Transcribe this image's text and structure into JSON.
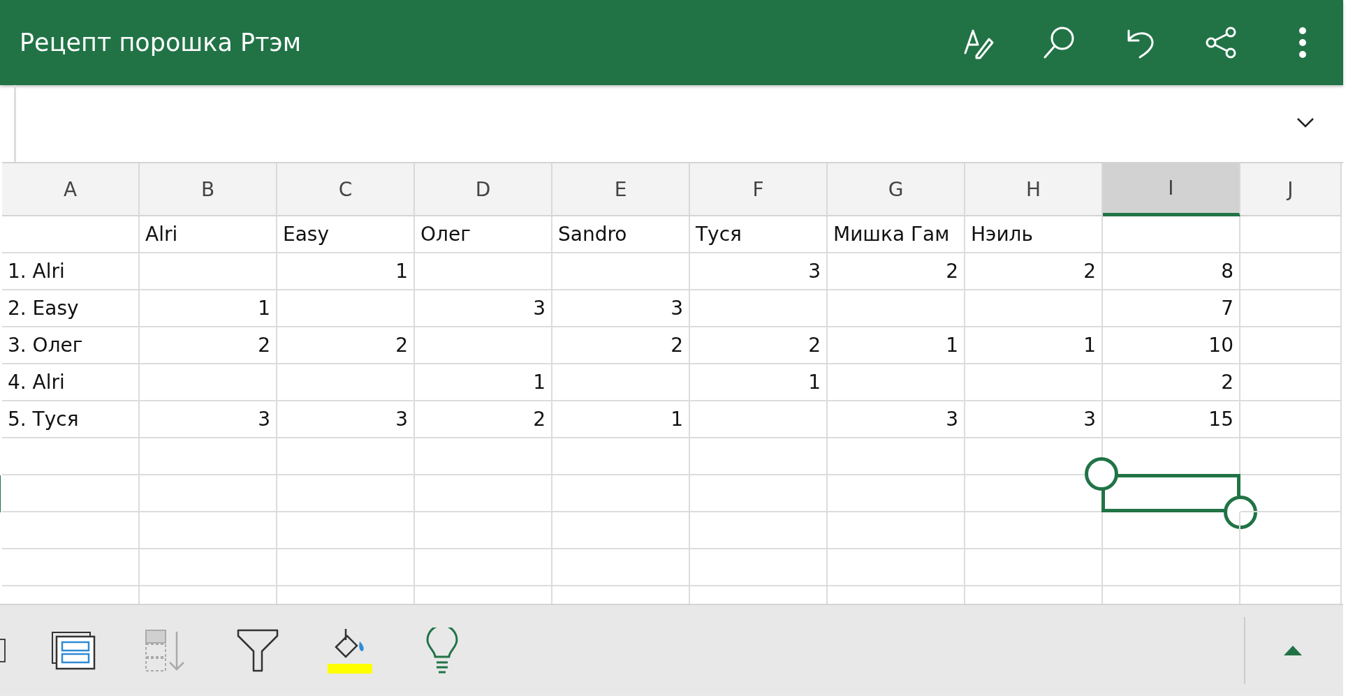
{
  "title": "Рецепт порошка Ртэм",
  "columns": [
    {
      "label": "A",
      "selected": false
    },
    {
      "label": "B",
      "selected": false
    },
    {
      "label": "C",
      "selected": false
    },
    {
      "label": "D",
      "selected": false
    },
    {
      "label": "E",
      "selected": false
    },
    {
      "label": "F",
      "selected": false
    },
    {
      "label": "G",
      "selected": false
    },
    {
      "label": "H",
      "selected": false
    },
    {
      "label": "I",
      "selected": true
    },
    {
      "label": "J",
      "selected": false
    }
  ],
  "rows": [
    {
      "selected": false,
      "cells": [
        null,
        {
          "text": "Alri",
          "kind": "text"
        },
        {
          "text": "Easy",
          "kind": "text"
        },
        {
          "text": "Олег",
          "kind": "text"
        },
        {
          "text": "Sandro",
          "kind": "text"
        },
        {
          "text": "Туся",
          "kind": "text"
        },
        {
          "text": "Мишка Гам",
          "kind": "text"
        },
        {
          "text": "Нэиль",
          "kind": "text"
        },
        null,
        null
      ]
    },
    {
      "selected": false,
      "cells": [
        {
          "text": "1. Alri",
          "kind": "text"
        },
        null,
        {
          "text": "1",
          "kind": "number"
        },
        null,
        null,
        {
          "text": "3",
          "kind": "number"
        },
        {
          "text": "2",
          "kind": "number"
        },
        {
          "text": "2",
          "kind": "number"
        },
        {
          "text": "8",
          "kind": "number"
        },
        null
      ]
    },
    {
      "selected": false,
      "cells": [
        {
          "text": "2. Easy",
          "kind": "text"
        },
        {
          "text": "1",
          "kind": "number"
        },
        null,
        {
          "text": "3",
          "kind": "number"
        },
        {
          "text": "3",
          "kind": "number"
        },
        null,
        null,
        null,
        {
          "text": "7",
          "kind": "number"
        },
        null
      ]
    },
    {
      "selected": false,
      "cells": [
        {
          "text": "3. Олег",
          "kind": "text"
        },
        {
          "text": "2",
          "kind": "number"
        },
        {
          "text": "2",
          "kind": "number"
        },
        null,
        {
          "text": "2",
          "kind": "number"
        },
        {
          "text": "2",
          "kind": "number"
        },
        {
          "text": "1",
          "kind": "number"
        },
        {
          "text": "1",
          "kind": "number"
        },
        {
          "text": "10",
          "kind": "number"
        },
        null
      ]
    },
    {
      "selected": false,
      "cells": [
        {
          "text": "4. Alri",
          "kind": "text"
        },
        null,
        null,
        {
          "text": "1",
          "kind": "number"
        },
        null,
        {
          "text": "1",
          "kind": "number"
        },
        null,
        null,
        {
          "text": "2",
          "kind": "number"
        },
        null
      ]
    },
    {
      "selected": false,
      "cells": [
        {
          "text": "5. Туся",
          "kind": "text"
        },
        {
          "text": "3",
          "kind": "number"
        },
        {
          "text": "3",
          "kind": "number"
        },
        {
          "text": "2",
          "kind": "number"
        },
        {
          "text": "1",
          "kind": "number"
        },
        null,
        {
          "text": "3",
          "kind": "number"
        },
        {
          "text": "3",
          "kind": "number"
        },
        {
          "text": "15",
          "kind": "number"
        },
        null
      ]
    },
    {
      "selected": false,
      "cells": []
    },
    {
      "selected": true,
      "cells": []
    },
    {
      "selected": false,
      "cells": []
    },
    {
      "selected": false,
      "cells": []
    },
    {
      "selected": false,
      "cells": []
    }
  ]
}
